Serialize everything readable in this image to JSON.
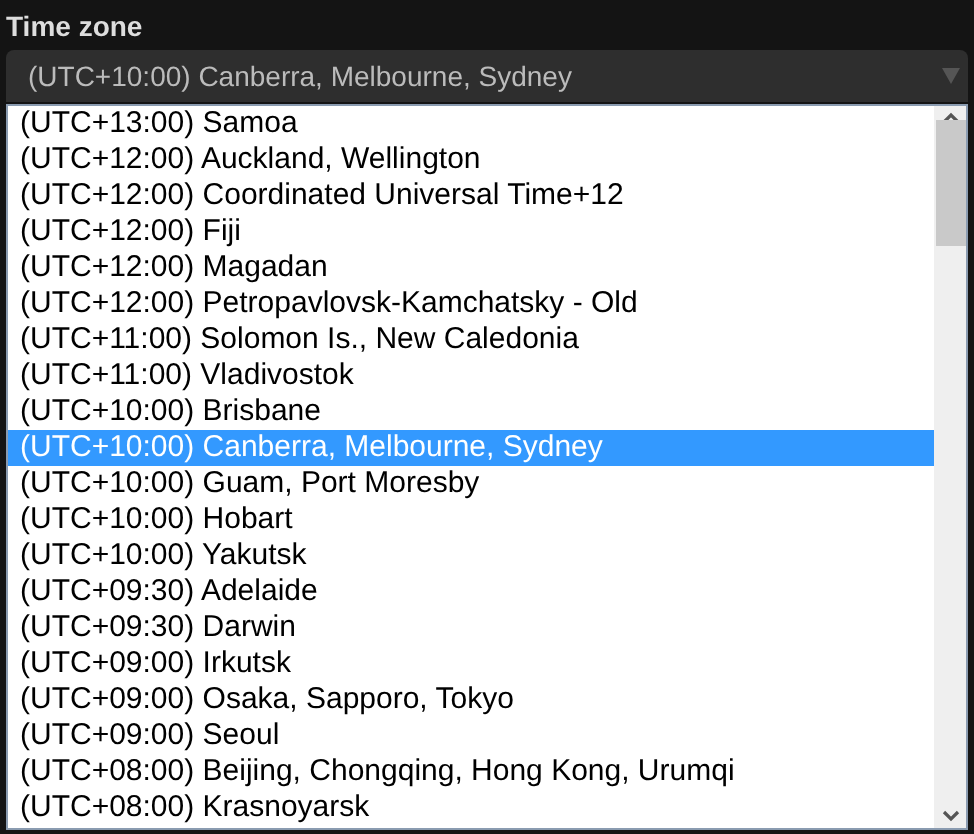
{
  "label": "Time zone",
  "select": {
    "value": "(UTC+10:00) Canberra, Melbourne, Sydney",
    "expanded": true
  },
  "options": [
    {
      "label": "(UTC+13:00) Samoa",
      "selected": false
    },
    {
      "label": "(UTC+12:00) Auckland, Wellington",
      "selected": false
    },
    {
      "label": "(UTC+12:00) Coordinated Universal Time+12",
      "selected": false
    },
    {
      "label": "(UTC+12:00) Fiji",
      "selected": false
    },
    {
      "label": "(UTC+12:00) Magadan",
      "selected": false
    },
    {
      "label": "(UTC+12:00) Petropavlovsk-Kamchatsky - Old",
      "selected": false
    },
    {
      "label": "(UTC+11:00) Solomon Is., New Caledonia",
      "selected": false
    },
    {
      "label": "(UTC+11:00) Vladivostok",
      "selected": false
    },
    {
      "label": "(UTC+10:00) Brisbane",
      "selected": false
    },
    {
      "label": "(UTC+10:00) Canberra, Melbourne, Sydney",
      "selected": true
    },
    {
      "label": "(UTC+10:00) Guam, Port Moresby",
      "selected": false
    },
    {
      "label": "(UTC+10:00) Hobart",
      "selected": false
    },
    {
      "label": "(UTC+10:00) Yakutsk",
      "selected": false
    },
    {
      "label": "(UTC+09:30) Adelaide",
      "selected": false
    },
    {
      "label": "(UTC+09:30) Darwin",
      "selected": false
    },
    {
      "label": "(UTC+09:00) Irkutsk",
      "selected": false
    },
    {
      "label": "(UTC+09:00) Osaka, Sapporo, Tokyo",
      "selected": false
    },
    {
      "label": "(UTC+09:00) Seoul",
      "selected": false
    },
    {
      "label": "(UTC+08:00) Beijing, Chongqing, Hong Kong, Urumqi",
      "selected": false
    },
    {
      "label": "(UTC+08:00) Krasnoyarsk",
      "selected": false
    }
  ]
}
